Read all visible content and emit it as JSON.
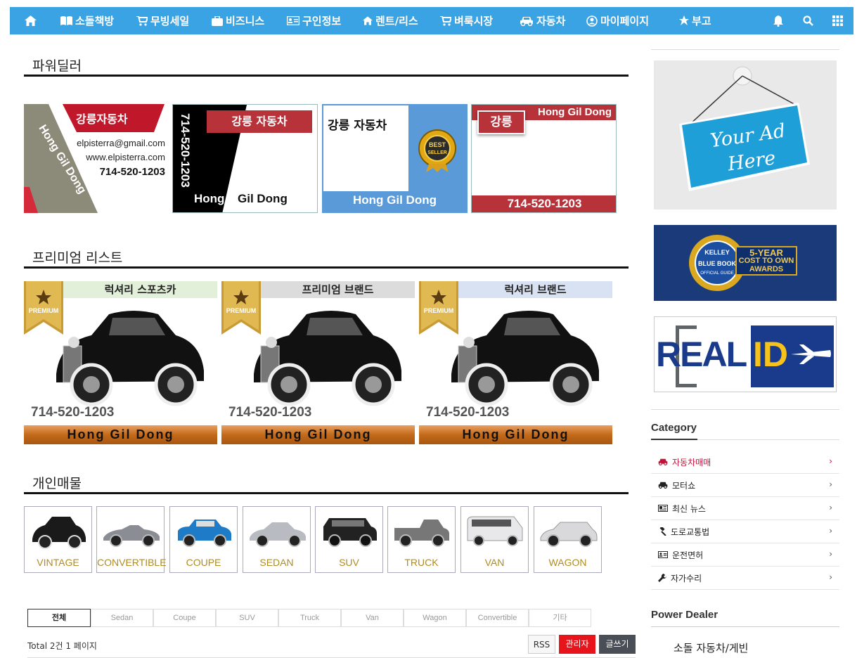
{
  "nav": {
    "items": [
      {
        "icon": "home-icon",
        "label": ""
      },
      {
        "icon": "book-icon",
        "label": "소돌책방"
      },
      {
        "icon": "cart-icon",
        "label": "무빙세일"
      },
      {
        "icon": "briefcase-icon",
        "label": "비즈니스"
      },
      {
        "icon": "id-card-icon",
        "label": "구인정보"
      },
      {
        "icon": "home-icon",
        "label": "렌트/리스"
      },
      {
        "icon": "cart-icon",
        "label": "벼룩시장"
      },
      {
        "icon": "car-icon",
        "label": "자동차"
      },
      {
        "icon": "user-circle-icon",
        "label": "마이페이지"
      },
      {
        "icon": "leaf-icon",
        "label": "부고"
      }
    ],
    "right_icons": [
      "bell-icon",
      "search-icon",
      "grid-icon"
    ]
  },
  "sections": {
    "power_dealer": "파워딜러",
    "premium": "프리미엄 리스트",
    "personal": "개인매물"
  },
  "dealer_cards": {
    "c1": {
      "company": "강릉자동차",
      "name": "Hong Gil Dong",
      "email": "elpisterra@gmail.com",
      "web": "www.elpisterra.com",
      "phone": "714-520-1203"
    },
    "c2": {
      "company": "강릉 자동차",
      "phone": "714-520-1203",
      "first": "Hong",
      "last": "Gil Dong"
    },
    "c3": {
      "company": "강릉 자동차",
      "badge_top": "BEST",
      "badge_bottom": "SELLER",
      "name": "Hong Gil Dong"
    },
    "c4": {
      "company": "강릉",
      "name": "Hong Gil Dong",
      "phone": "714-520-1203"
    }
  },
  "premium_cards": [
    {
      "category": "럭셔리 스포츠카",
      "badge": "PREMIUM",
      "phone": "714-520-1203",
      "name": "Hong Gil Dong",
      "label_bg": "#e2efd9"
    },
    {
      "category": "프리미엄 브랜드",
      "badge": "PREMIUM",
      "phone": "714-520-1203",
      "name": "Hong Gil Dong",
      "label_bg": "#dcdcdc"
    },
    {
      "category": "럭셔리 브랜드",
      "badge": "PREMIUM",
      "phone": "714-520-1203",
      "name": "Hong Gil Dong",
      "label_bg": "#d9e2f3"
    }
  ],
  "personal_types": [
    "VINTAGE",
    "CONVERTIBLE",
    "COUPE",
    "SEDAN",
    "SUV",
    "TRUCK",
    "VAN",
    "WAGON"
  ],
  "board": {
    "tabs": [
      "전체",
      "Sedan",
      "Coupe",
      "SUV",
      "Truck",
      "Van",
      "Wagon",
      "Convertible",
      "기타"
    ],
    "active_tab": "전체",
    "total": "Total 2건 1 페이지",
    "rss": "RSS",
    "admin": "관리자",
    "write": "글쓰기"
  },
  "sidebar": {
    "ad1_line1": "Your Ad",
    "ad1_line2": "Here",
    "kbb_circle_top": "KELLEY",
    "kbb_circle_mid": "BLUE BOOK",
    "kbb_circle_bottom": "OFFICIAL GUIDE",
    "kbb_text_1": "5-YEAR",
    "kbb_text_2": "COST TO OWN",
    "kbb_text_3": "AWARDS",
    "realid_a": "REAL",
    "realid_b": "ID",
    "category_title": "Category",
    "categories": [
      {
        "icon": "car-icon",
        "label": "자동차매매",
        "active": true
      },
      {
        "icon": "car-icon",
        "label": "모터쇼",
        "active": false
      },
      {
        "icon": "newspaper-icon",
        "label": "최신 뉴스",
        "active": false
      },
      {
        "icon": "gavel-icon",
        "label": "도로교통법",
        "active": false
      },
      {
        "icon": "id-card-icon",
        "label": "운전면허",
        "active": false
      },
      {
        "icon": "wrench-icon",
        "label": "자가수리",
        "active": false
      }
    ],
    "power_dealer_title": "Power Dealer",
    "power_dealer_first": "소돌 자동차/게빈"
  },
  "colors": {
    "nav": "#3aa3e3",
    "active_category": "#c0143c",
    "admin_btn": "#e8141c",
    "write_btn": "#4a4f57",
    "dealer_red": "#b8323a",
    "dealer_blue": "#5a9ad8"
  }
}
